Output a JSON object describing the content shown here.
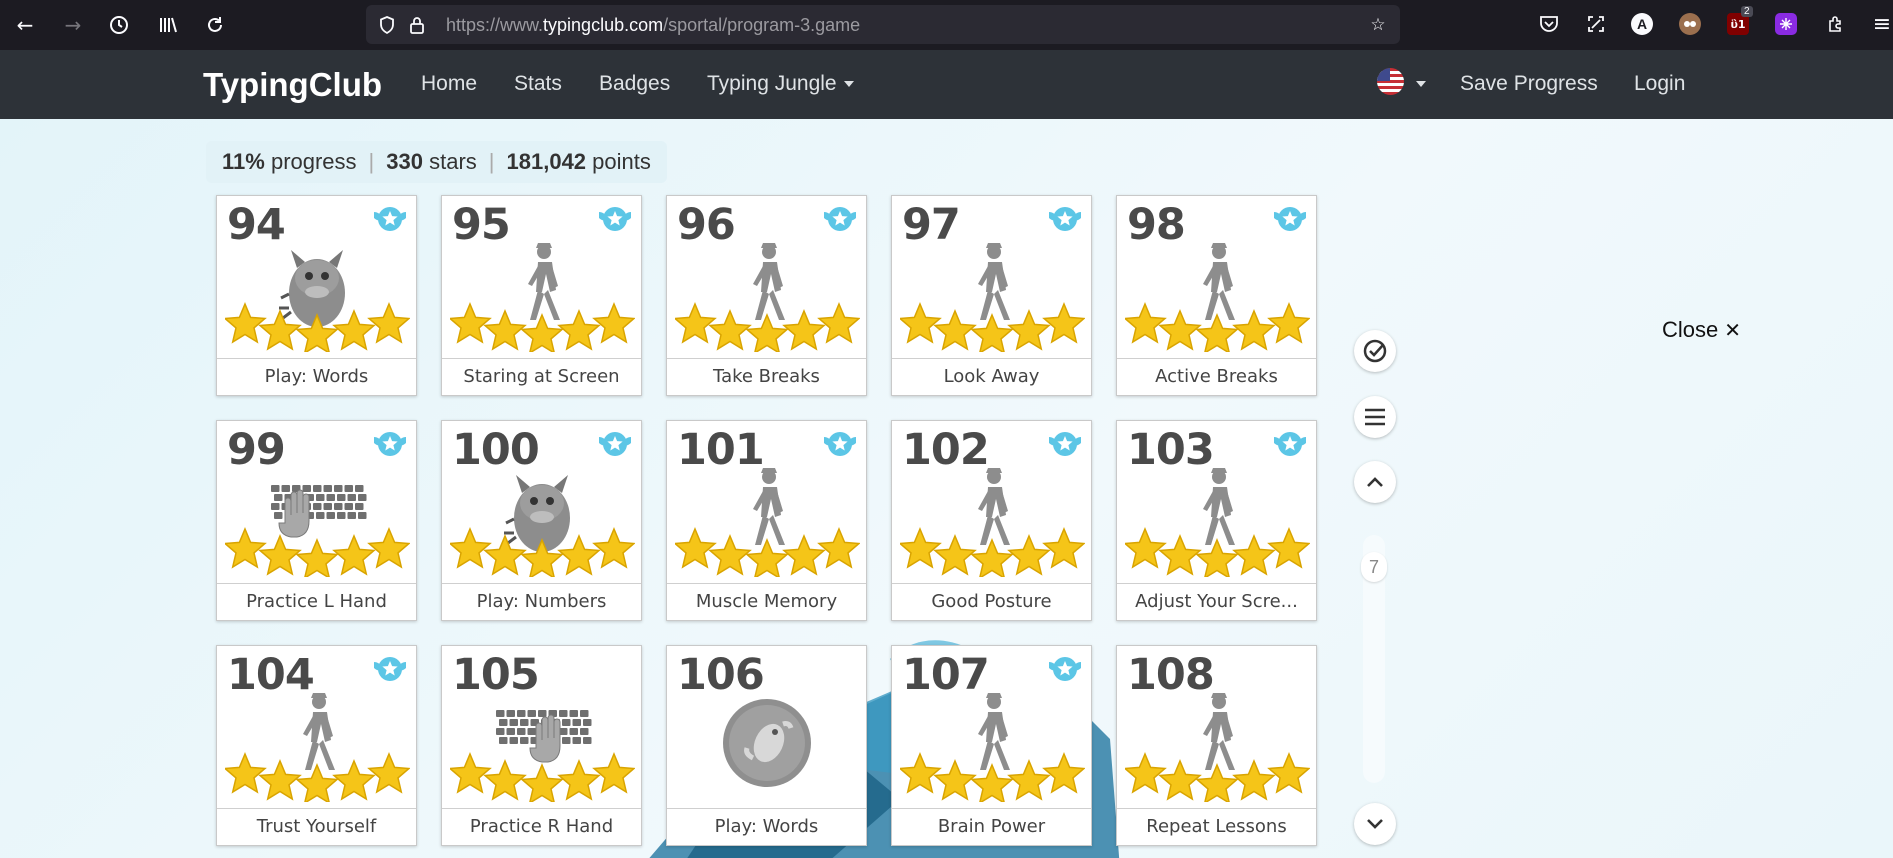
{
  "browser": {
    "url_prefix": "https://www.",
    "url_host": "typingclub.com",
    "url_path": "/sportal/program-3.game",
    "notification_badge": "2"
  },
  "site_nav": {
    "brand": "TypingClub",
    "links": [
      "Home",
      "Stats",
      "Badges",
      "Typing Jungle"
    ],
    "save_progress": "Save Progress",
    "login": "Login"
  },
  "progress": {
    "percent": "11%",
    "percent_label": "progress",
    "stars": "330",
    "stars_label": "stars",
    "points": "181,042",
    "points_label": "points"
  },
  "lessons": [
    {
      "num": "94",
      "label": "Play: Words",
      "icon": "monster-icon",
      "stars": 5,
      "badge": true
    },
    {
      "num": "95",
      "label": "Staring at Screen",
      "icon": "walker-icon",
      "stars": 5,
      "badge": true
    },
    {
      "num": "96",
      "label": "Take Breaks",
      "icon": "walker-icon",
      "stars": 5,
      "badge": true
    },
    {
      "num": "97",
      "label": "Look Away",
      "icon": "walker-icon",
      "stars": 5,
      "badge": true
    },
    {
      "num": "98",
      "label": "Active Breaks",
      "icon": "walker-icon",
      "stars": 5,
      "badge": true
    },
    {
      "num": "99",
      "label": "Practice L Hand",
      "icon": "keyboard-hand-left-icon",
      "stars": 5,
      "badge": true
    },
    {
      "num": "100",
      "label": "Play: Numbers",
      "icon": "monster-icon",
      "stars": 5,
      "badge": true
    },
    {
      "num": "101",
      "label": "Muscle Memory",
      "icon": "walker-icon",
      "stars": 5,
      "badge": true
    },
    {
      "num": "102",
      "label": "Good Posture",
      "icon": "walker-icon",
      "stars": 5,
      "badge": true
    },
    {
      "num": "103",
      "label": "Adjust Your Scre...",
      "icon": "walker-icon",
      "stars": 5,
      "badge": true
    },
    {
      "num": "104",
      "label": "Trust Yourself",
      "icon": "walker-icon",
      "stars": 5,
      "badge": true
    },
    {
      "num": "105",
      "label": "Practice R Hand",
      "icon": "keyboard-hand-right-icon",
      "stars": 5,
      "badge": false
    },
    {
      "num": "106",
      "label": "Play: Words",
      "icon": "game-coin-icon",
      "stars": 0,
      "badge": false
    },
    {
      "num": "107",
      "label": "Brain Power",
      "icon": "walker-icon",
      "stars": 5,
      "badge": true
    },
    {
      "num": "108",
      "label": "Repeat Lessons",
      "icon": "walker-icon",
      "stars": 5,
      "badge": false
    }
  ],
  "controls": {
    "scroll_position": "7",
    "close_label": "Close",
    "close_symbol": "✕"
  },
  "colors": {
    "star": "#f5c518",
    "badge": "#5cc6e6",
    "figure": "#8d8d8d",
    "nav_bg": "#2d3238"
  }
}
